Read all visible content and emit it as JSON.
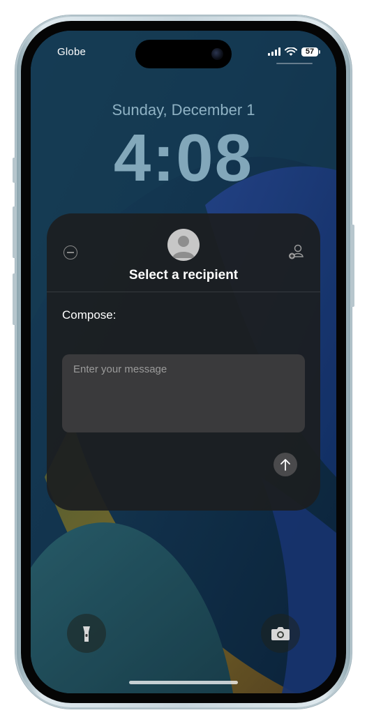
{
  "status_bar": {
    "carrier": "Globe",
    "battery": "57",
    "signal_icon": "cellular-signal-icon",
    "wifi_icon": "wifi-icon"
  },
  "lock_screen": {
    "date": "Sunday, December 1",
    "time": "4:08"
  },
  "message_card": {
    "title": "Select a recipient",
    "compose_label": "Compose:",
    "message_placeholder": "Enter your message",
    "icons": {
      "close": "minus-circle-icon",
      "avatar": "person-avatar-icon",
      "add_contact": "add-contact-icon",
      "send": "arrow-up-icon"
    }
  },
  "bottom_controls": {
    "left": "flashlight-icon",
    "right": "camera-icon"
  },
  "colors": {
    "card_background": "#1c1e20",
    "input_background": "#3a3a3c",
    "accent_text": "#ffffff"
  }
}
